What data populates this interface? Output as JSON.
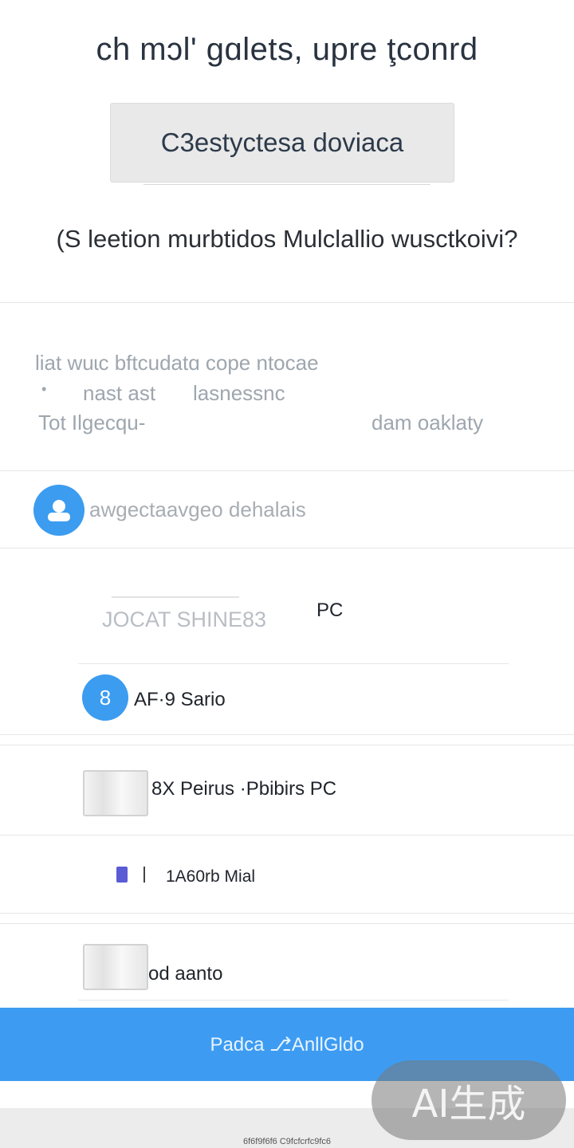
{
  "header": {
    "title": "ch mɔl' gɑlets, upre ţconrd"
  },
  "device_chip": {
    "label": "C3estyctesa doviaca"
  },
  "question": {
    "text": "(S leetion murbtidos Mulclallio wusctkoivi?"
  },
  "info": {
    "line1": "liat wuɩc bftcudatɑ cope ntocae",
    "line2": "nast ast",
    "line2b": "lasnessnc",
    "line3a": "Tot Ilgecqu-",
    "line3b": "dam oaklaty"
  },
  "account": {
    "text": "awgectaavgeo  dehalais"
  },
  "devices": {
    "row1": {
      "faded": "JOCAT SHINE83",
      "label": "PC"
    },
    "row2": {
      "label": "AF·9 Sario"
    },
    "row3": {
      "label": "8X Peirus  ·Pbibirs PC"
    },
    "row4": {
      "label": "1A60rb  Mial"
    },
    "row5": {
      "label": "od aanto"
    }
  },
  "action": {
    "label": "Padca ⎇AnllGldo"
  },
  "footer": {
    "text": "6f6f9f6f6 C9fcfcrfc9fc6"
  },
  "watermark": {
    "text": "AI生成"
  },
  "colors": {
    "accent": "#3d9cf2",
    "text": "#20252c",
    "muted": "#a7adb3"
  }
}
